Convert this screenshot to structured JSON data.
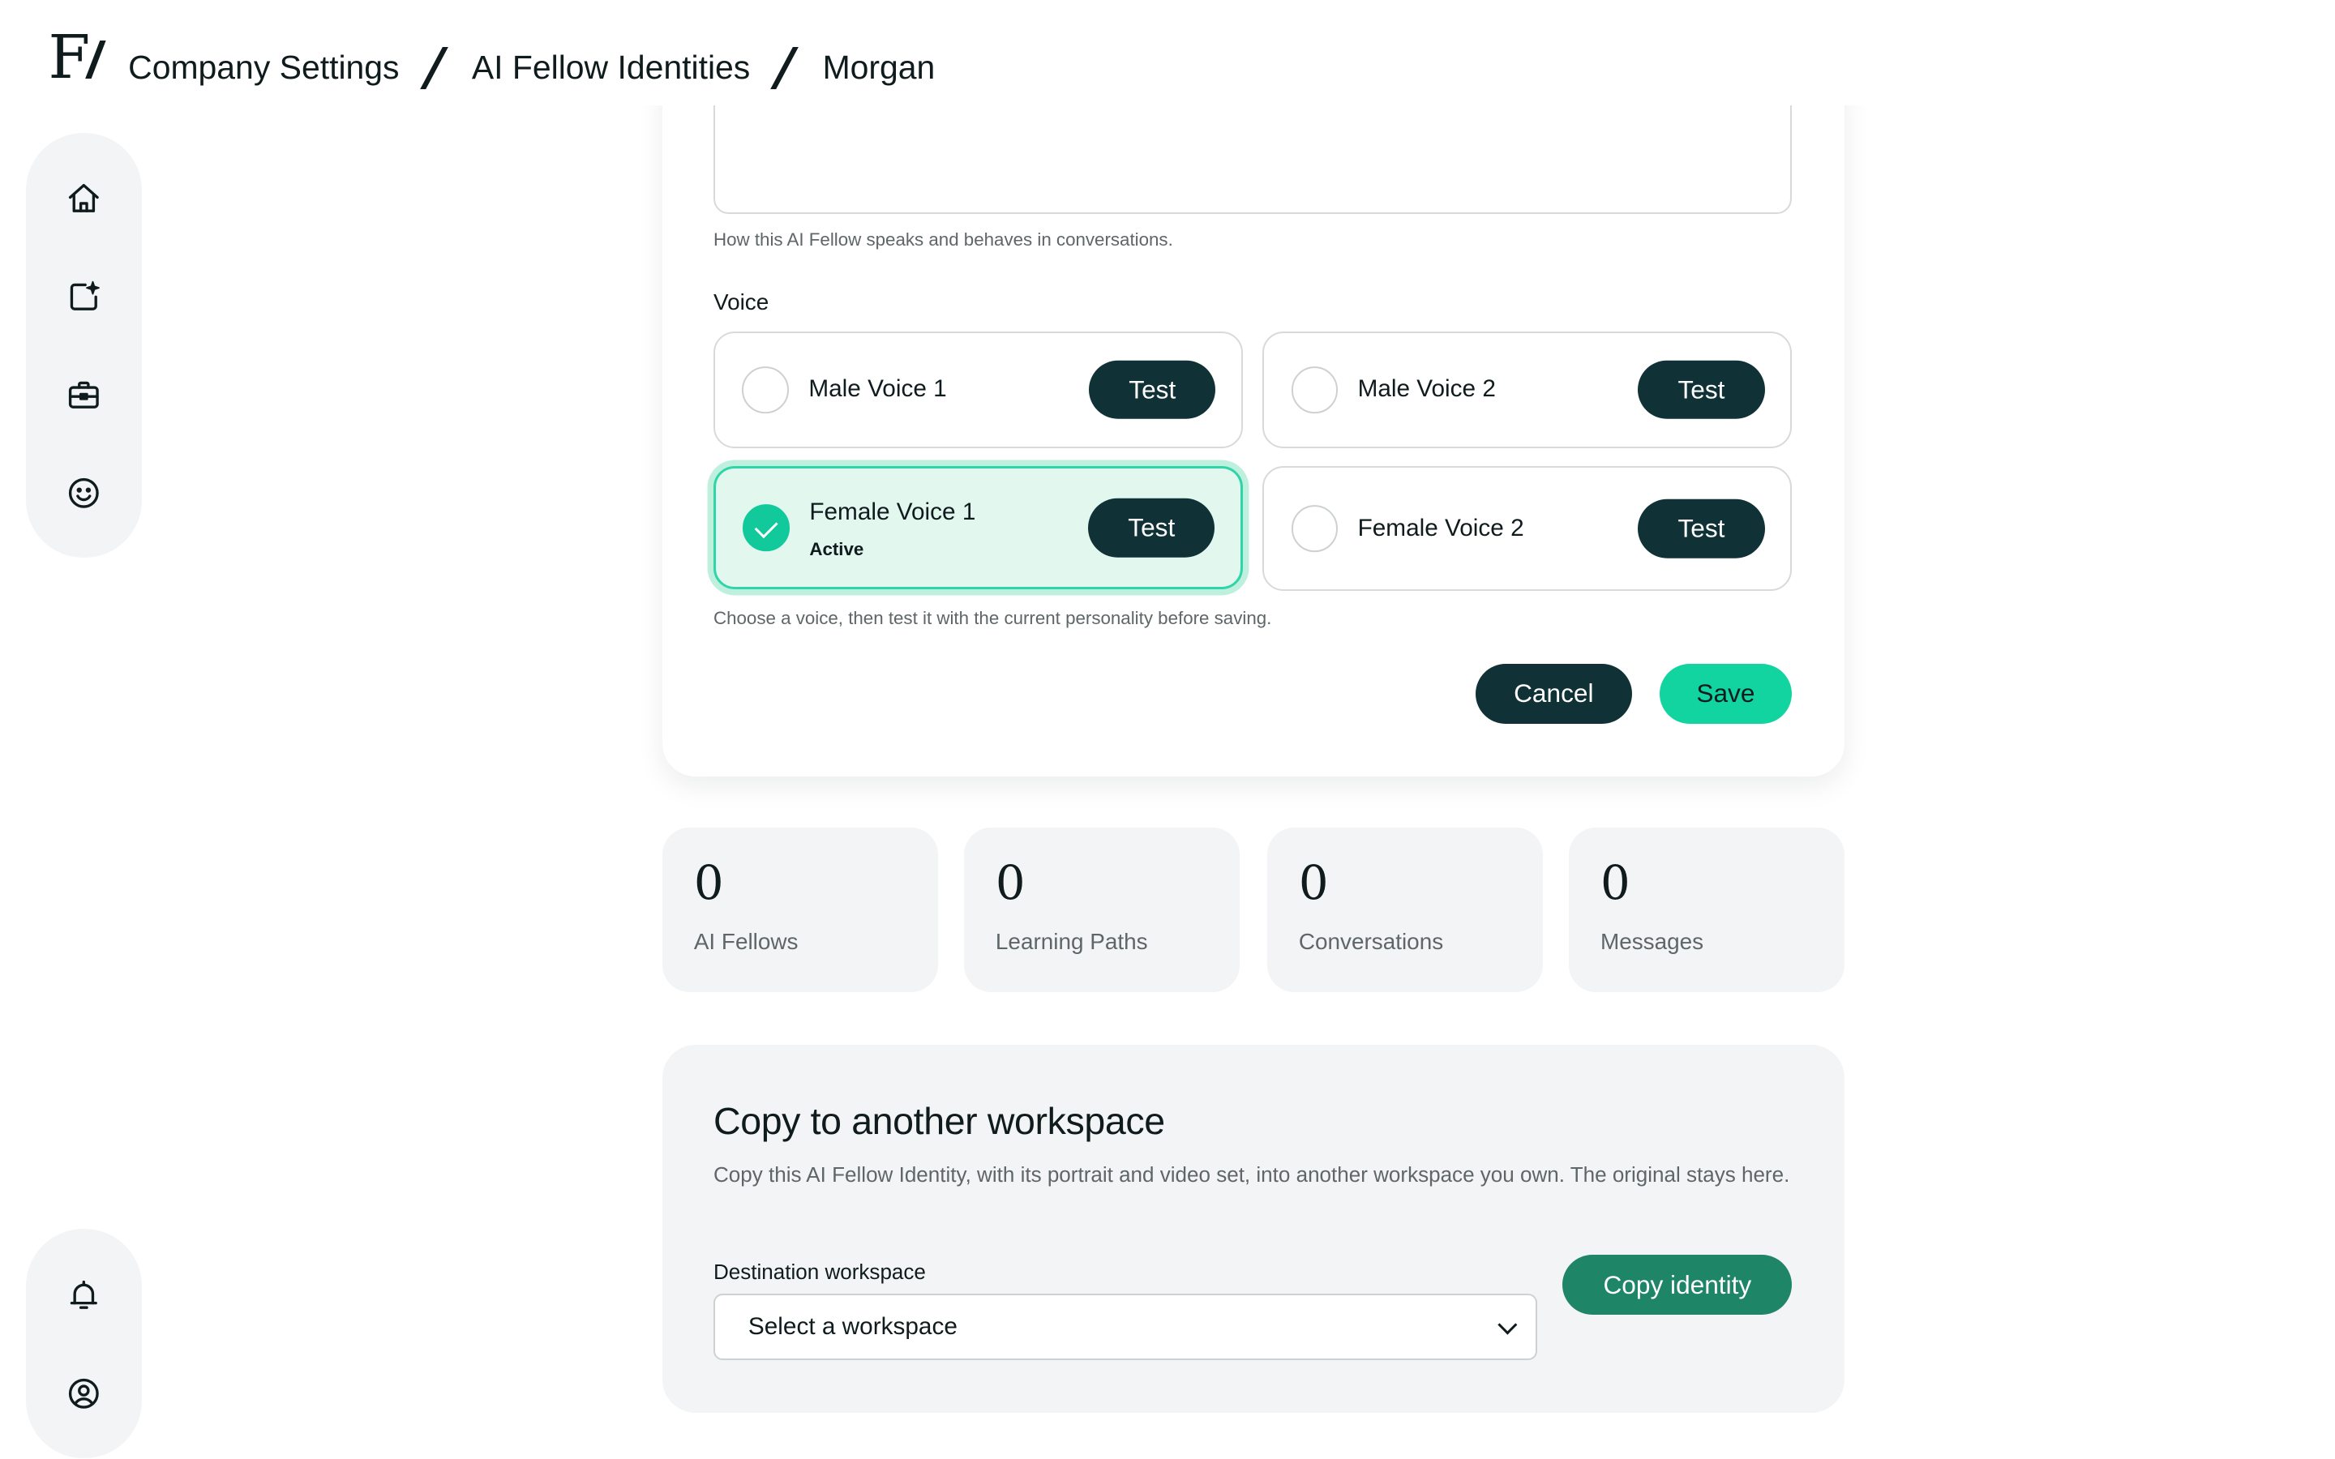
{
  "header": {
    "logo": "F/",
    "breadcrumbs": [
      "Company Settings",
      "AI Fellow Identities",
      "Morgan"
    ]
  },
  "sidebar": {
    "top_items": [
      "home-icon",
      "new-post-icon",
      "briefcase-icon",
      "smiley-icon"
    ],
    "bottom_items": [
      "bell-icon",
      "user-circle-icon"
    ]
  },
  "form": {
    "personality_help": "How this AI Fellow speaks and behaves in conversations.",
    "voice_label": "Voice",
    "voices": [
      {
        "name": "Male Voice 1",
        "selected": false,
        "test_label": "Test"
      },
      {
        "name": "Male Voice 2",
        "selected": false,
        "test_label": "Test"
      },
      {
        "name": "Female Voice 1",
        "selected": true,
        "status": "Active",
        "test_label": "Test"
      },
      {
        "name": "Female Voice 2",
        "selected": false,
        "test_label": "Test"
      }
    ],
    "voice_help": "Choose a voice, then test it with the current personality before saving.",
    "cancel_label": "Cancel",
    "save_label": "Save"
  },
  "stats": [
    {
      "value": "0",
      "label": "AI Fellows"
    },
    {
      "value": "0",
      "label": "Learning Paths"
    },
    {
      "value": "0",
      "label": "Conversations"
    },
    {
      "value": "0",
      "label": "Messages"
    }
  ],
  "copy_panel": {
    "title": "Copy to another workspace",
    "description": "Copy this AI Fellow Identity, with its portrait and video set, into another workspace you own. The original stays here.",
    "destination_label": "Destination workspace",
    "select_value": "Select a workspace",
    "button_label": "Copy identity"
  },
  "colors": {
    "dark_button": "#103236",
    "accent": "#11d4a0",
    "copy_button": "#1f8567",
    "active_bg": "#e2f8ef"
  }
}
